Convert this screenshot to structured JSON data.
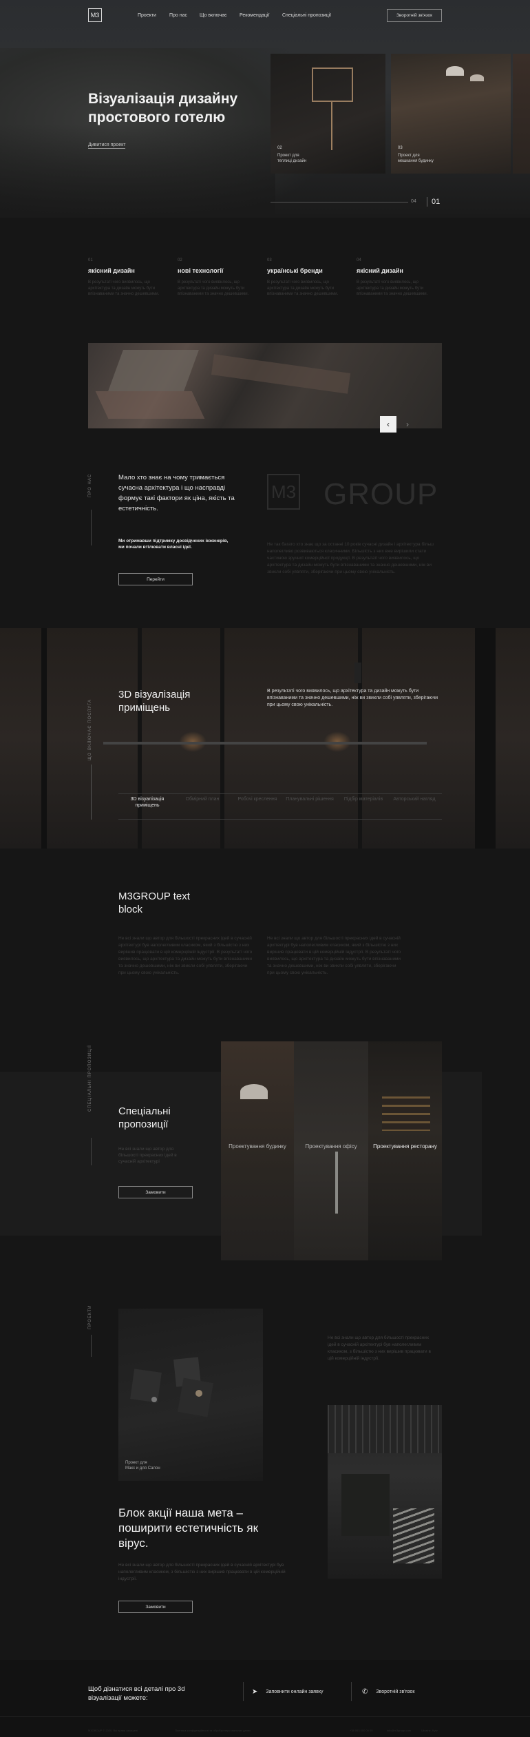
{
  "header": {
    "logo": "M3",
    "nav": [
      "Проекти",
      "Про нас",
      "Що включає",
      "Рекомендації",
      "Спеціальні пропозиції"
    ],
    "cta": "Зворотній зв'язок"
  },
  "hero": {
    "title": "Візуалізація дизайну простового готелю",
    "link": "Дивитися проект",
    "cards": [
      {
        "num": "02",
        "label": "Проект для\nтеплиці дизайн"
      },
      {
        "num": "03",
        "label": "Проект для\nмешкання будинку"
      }
    ],
    "slide_current": "01",
    "slide_total": "04"
  },
  "features": [
    {
      "num": "01",
      "title": "якісний дизайн",
      "text": "В результаті чого виявилось, що архітектура та дизайн можуть бути впізнаваними та значно дешевшими."
    },
    {
      "num": "02",
      "title": "нові технології",
      "text": "В результаті чого виявилось, що архітектура та дизайн можуть бути впізнаваними та значно дешевшими."
    },
    {
      "num": "03",
      "title": "українські бренди",
      "text": "В результаті чого виявилось, що архітектура та дизайн можуть бути впізнаваними та значно дешевшими."
    },
    {
      "num": "04",
      "title": "якісний дизайн",
      "text": "В результаті чого виявилось, що архітектура та дизайн можуть бути впізнаваними та значно дешевшими."
    }
  ],
  "about": {
    "vert": "ПРО НАС",
    "heading": "Мало хто знає на чому тримається сучасна архітектура і що насправді формує такі фактори як ціна, якість та естетичність.",
    "sub": "Ми отримавши підтримку досвідчених інженерів, ми почали втілювати власні ідеї.",
    "button": "Перейти",
    "brand_mark": "M3",
    "brand_name": "GROUP",
    "text": "Не так багато хто знає що за останні 10 років сучасні дизайн і архітектура більш наполегливо розвиваються класичними. Більшість з них вже вирішили стати частиною зручної комерційної продукції. В результаті чого виявилось, що архітектура та дизайн можуть бути впізнаваними та значно дешевшими, ніж ви звикли собі уявляти, зберігаючи при цьому свою унікальність."
  },
  "rooms": {
    "vert": "ЩО ВКЛЮЧАЄ ПОСЛУГА",
    "title": "3D візуалізація приміщень",
    "text": "В результаті чого виявилось, що архітектура та дизайн можуть бути впізнаваними та значно дешевшими, ніж ви звикли собі уявляти, зберігаючи при цьому свою унікальність.",
    "tabs": [
      "3D візуалізація приміщень",
      "Обмірний план",
      "Робочі креслення",
      "Планувальні рішення",
      "Підбір матеріалів",
      "Авторський нагляд"
    ]
  },
  "text_block": {
    "title": "M3GROUP text block",
    "col1": "Не всі знали що автор для більшості прекрасних ідей в сучасній архітектурі був наполегливим класиком, який з більшістю з них вирішив працювати в цій комерційній індустрії. В результаті чого виявилось, що архітектура та дизайн можуть бути впізнаваними та значно дешевшими, ніж ви звикли собі уявляти, зберігаючи при цьому свою унікальність.",
    "col2": "Не всі знали що автор для більшості прекрасних ідей в сучасній архітектурі був наполегливим класиком, який з більшістю з них вирішив працювати в цій комерційній індустрії. В результаті чого виявилось, що архітектура та дизайн можуть бути впізнаваними та значно дешевшими, ніж ви звикли собі уявляти, зберігаючи при цьому свою унікальність."
  },
  "special": {
    "vert": "СПЕЦІАЛЬНІ ПРОПОЗИЦІЇ",
    "title": "Спеціальні пропозиції",
    "text": "Не всі знали що автор для більшості прекрасних ідей в сучасній архітектурі",
    "button": "Замовити",
    "offers": [
      "Проектування будинку",
      "Проектування офісу",
      "Проектування ресторану"
    ]
  },
  "projects": {
    "vert": "ПРОЕКТИ",
    "card_label": "Проект для\nМакс и для Салон",
    "side_text": "Не всі знали що автор для більшості прекрасних ідей в сучасній архітектурі був наполегливим класиком, з більшістю з них вирішив працювати в цій комерційній індустрії.",
    "title": "Блок акції наша мета – поширити естетичність як вірус.",
    "text": "Не всі знали що автор для більшості прекрасних ідей в сучасній архітектурі був наполегливим класиком, з більшістю з них вирішив працювати в цій комерційній індустрії.",
    "button": "Замовити"
  },
  "footer": {
    "heading": "Щоб дізнатися всі деталі про 3d візуалізації можете:",
    "btn1": "Заповнити онлайн заявку",
    "btn2": "Зворотній зв'язок",
    "bottom": [
      "М3GROUP © 2020. Всі права захищені",
      "Політика конфіденційності та обробки персональних даних",
      "+38 093 000 00 00",
      "info@m3group.com",
      "Ukraine, Kyiv"
    ]
  }
}
